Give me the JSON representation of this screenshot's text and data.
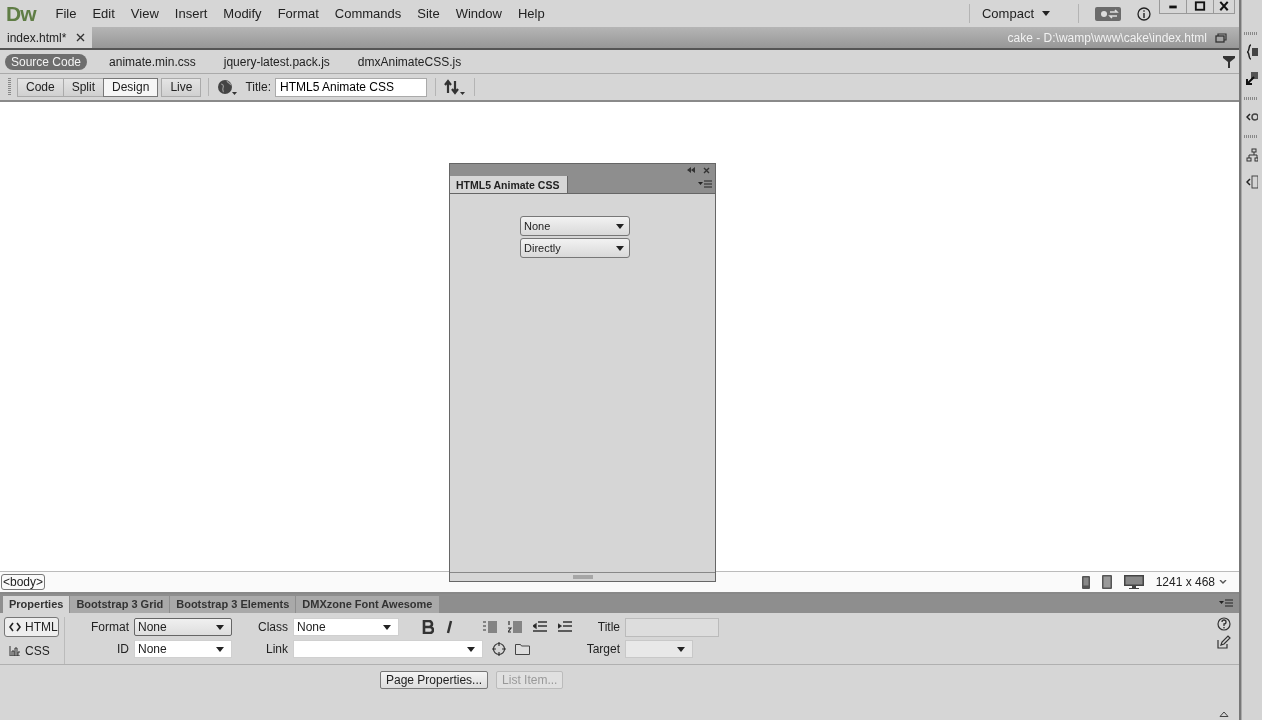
{
  "app": {
    "logo": "Dw"
  },
  "menu": [
    "File",
    "Edit",
    "View",
    "Insert",
    "Modify",
    "Format",
    "Commands",
    "Site",
    "Window",
    "Help"
  ],
  "workspace": {
    "label": "Compact"
  },
  "document_tabs": [
    {
      "label": "index.html*",
      "selected": true
    }
  ],
  "document_path": "cake - D:\\wamp\\www\\cake\\index.html",
  "related_files": [
    {
      "label": "Source Code",
      "selected": true
    },
    {
      "label": "animate.min.css",
      "selected": false
    },
    {
      "label": "jquery-latest.pack.js",
      "selected": false
    },
    {
      "label": "dmxAnimateCSS.js",
      "selected": false
    }
  ],
  "view_buttons": [
    {
      "label": "Code",
      "selected": false
    },
    {
      "label": "Split",
      "selected": false
    },
    {
      "label": "Design",
      "selected": true
    },
    {
      "label": "Live",
      "selected": false
    }
  ],
  "title_field": {
    "label": "Title:",
    "value": "HTML5 Animate CSS"
  },
  "floating_panel": {
    "tab": "HTML5 Animate CSS",
    "selects": [
      "None",
      "Directly"
    ]
  },
  "status_bar": {
    "tag": "<body>",
    "size": "1241 x 468"
  },
  "panel_tabs": [
    {
      "label": "Properties",
      "selected": true
    },
    {
      "label": "Bootstrap 3 Grid",
      "selected": false
    },
    {
      "label": "Bootstrap 3 Elements",
      "selected": false
    },
    {
      "label": "DMXzone Font Awesome",
      "selected": false
    }
  ],
  "properties": {
    "mode_buttons": [
      {
        "label": "HTML",
        "selected": true
      },
      {
        "label": "CSS",
        "selected": false
      }
    ],
    "format": {
      "label": "Format",
      "value": "None"
    },
    "id": {
      "label": "ID",
      "value": "None"
    },
    "class": {
      "label": "Class",
      "value": "None"
    },
    "link": {
      "label": "Link"
    },
    "title": {
      "label": "Title"
    },
    "target": {
      "label": "Target"
    },
    "buttons": [
      {
        "label": "Page Properties...",
        "disabled": false
      },
      {
        "label": "List Item...",
        "disabled": true
      }
    ]
  }
}
